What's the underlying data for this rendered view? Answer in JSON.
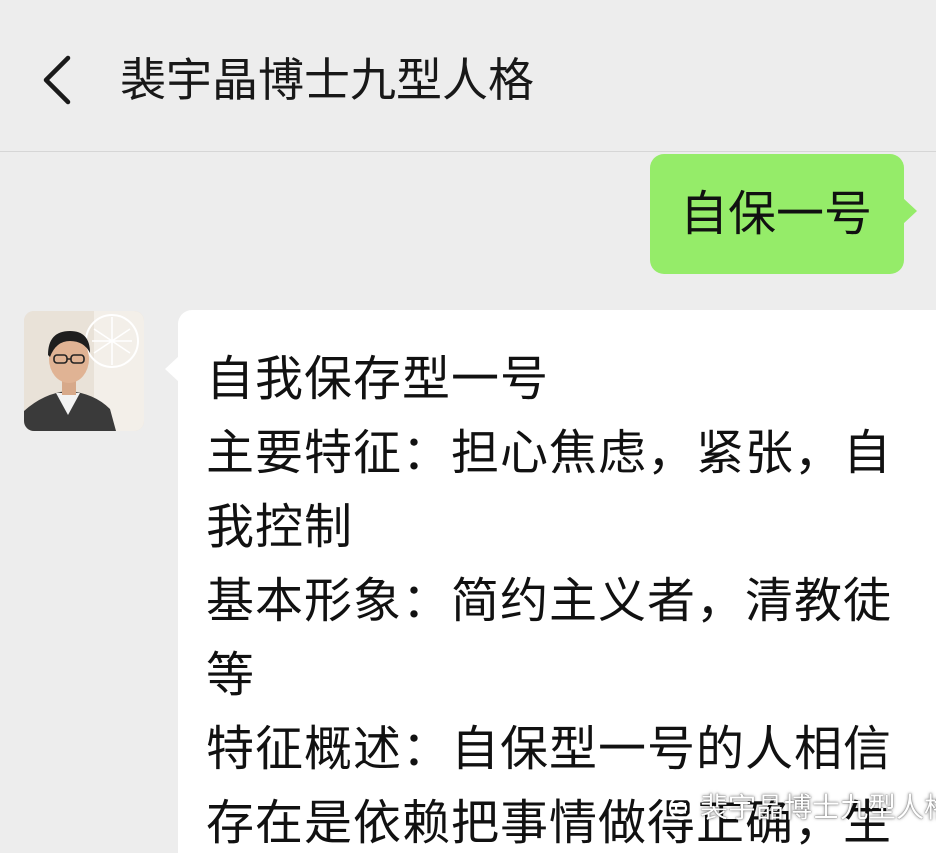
{
  "header": {
    "title": "裴宇晶博士九型人格",
    "back_icon": "chevron-left-icon"
  },
  "messages": {
    "outgoing": {
      "text": "自保一号",
      "bubble_color": "#95ec69"
    },
    "incoming": {
      "bubble_color": "#ffffff",
      "lines": [
        "自我保存型一号",
        "主要特征：担心焦虑，紧张，自",
        "我控制",
        "基本形象：简约主义者，清教徒",
        "等",
        "特征概述：自保型一号的人相信",
        "存在是依赖把事情做得正确，生"
      ]
    }
  },
  "avatar": {
    "icon": "person-avatar-icon"
  },
  "watermark": {
    "text": "裴宇晶博士九型人格",
    "icon": "wechat-official-account-icon"
  }
}
